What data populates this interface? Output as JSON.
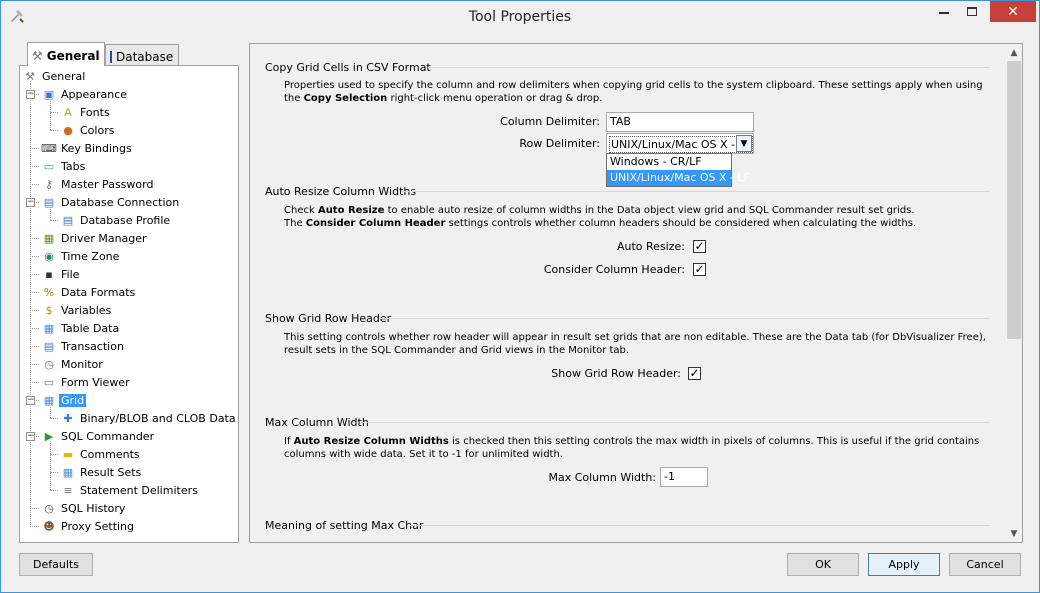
{
  "window": {
    "title": "Tool Properties",
    "close_glyph": "✕"
  },
  "tabs": [
    {
      "label": "General",
      "icon": "tools-icon",
      "active": true
    },
    {
      "label": "Database",
      "icon": "database-icon",
      "active": false
    }
  ],
  "tree": {
    "items": [
      {
        "label": "General",
        "icon": "tools-icon",
        "glyph": "⚒",
        "color": "#7a7a7a"
      },
      {
        "label": "Appearance",
        "icon": "monitor-icon",
        "glyph": "▣",
        "color": "#3a7bd5"
      },
      {
        "label": "Fonts",
        "icon": "font-icon",
        "glyph": "A",
        "color": "#d49b00"
      },
      {
        "label": "Colors",
        "icon": "palette-icon",
        "glyph": "●",
        "color": "#d2691e"
      },
      {
        "label": "Key Bindings",
        "icon": "keyboard-icon",
        "glyph": "⌨",
        "color": "#444444"
      },
      {
        "label": "Tabs",
        "icon": "tabs-icon",
        "glyph": "▭",
        "color": "#4a90d9"
      },
      {
        "label": "Master Password",
        "icon": "key-icon",
        "glyph": "⚷",
        "color": "#777777"
      },
      {
        "label": "Database Connection",
        "icon": "database-connection-icon",
        "glyph": "▤",
        "color": "#3a7bd5"
      },
      {
        "label": "Database Profile",
        "icon": "database-profile-icon",
        "glyph": "▤",
        "color": "#3a7bd5"
      },
      {
        "label": "Driver Manager",
        "icon": "driver-icon",
        "glyph": "▦",
        "color": "#6b8e23"
      },
      {
        "label": "Time Zone",
        "icon": "globe-icon",
        "glyph": "◉",
        "color": "#2e8b57"
      },
      {
        "label": "File",
        "icon": "floppy-icon",
        "glyph": "▪",
        "color": "#333333"
      },
      {
        "label": "Data Formats",
        "icon": "percent-icon",
        "glyph": "%",
        "color": "#b8860b"
      },
      {
        "label": "Variables",
        "icon": "dollar-icon",
        "glyph": "$",
        "color": "#b8860b"
      },
      {
        "label": "Table Data",
        "icon": "table-icon",
        "glyph": "▦",
        "color": "#4a90d9"
      },
      {
        "label": "Transaction",
        "icon": "transaction-icon",
        "glyph": "▤",
        "color": "#3a7bd5"
      },
      {
        "label": "Monitor",
        "icon": "monitor-clock-icon",
        "glyph": "◷",
        "color": "#3a7bd5"
      },
      {
        "label": "Form Viewer",
        "icon": "form-icon",
        "glyph": "▭",
        "color": "#777777"
      },
      {
        "label": "Grid",
        "icon": "grid-icon",
        "glyph": "▦",
        "color": "#4a90d9"
      },
      {
        "label": "Binary/BLOB and CLOB Data",
        "icon": "puzzle-icon",
        "glyph": "✚",
        "color": "#3a7bd5"
      },
      {
        "label": "SQL Commander",
        "icon": "play-icon",
        "glyph": "▶",
        "color": "#2e9e2e"
      },
      {
        "label": "Comments",
        "icon": "note-icon",
        "glyph": "▬",
        "color": "#e6b800"
      },
      {
        "label": "Result Sets",
        "icon": "result-grid-icon",
        "glyph": "▦",
        "color": "#4a90d9"
      },
      {
        "label": "Statement Delimiters",
        "icon": "delimiter-icon",
        "glyph": "≡",
        "color": "#777777"
      },
      {
        "label": "SQL History",
        "icon": "history-icon",
        "glyph": "◷",
        "color": "#555555"
      },
      {
        "label": "Proxy Setting",
        "icon": "proxy-icon",
        "glyph": "☻",
        "color": "#8b5a2b"
      }
    ]
  },
  "sections": {
    "csv": {
      "title": "Copy Grid Cells in CSV Format",
      "desc_a": "Properties used to specify the column and row delimiters when copying grid cells to the system clipboard. These settings apply when using the ",
      "desc_b": "Copy Selection",
      "desc_c": " right-click menu operation or drag & drop.",
      "column_delimiter_label": "Column Delimiter:",
      "column_delimiter_value": "TAB",
      "row_delimiter_label": "Row Delimiter:",
      "row_delimiter_value": "UNIX/Linux/Mac OS X - LF",
      "row_delimiter_options": [
        "Windows - CR/LF",
        "UNIX/Linux/Mac OS X - LF"
      ]
    },
    "auto_resize": {
      "title": "Auto Resize Column Widths",
      "line1_a": "Check ",
      "line1_b": "Auto Resize",
      "line1_c": " to enable auto resize of column widths in the Data object view grid and SQL Commander result set grids.",
      "line2_a": "The ",
      "line2_b": "Consider Column Header",
      "line2_c": " settings controls whether column headers should be considered when calculating the widths.",
      "auto_resize_label": "Auto Resize:",
      "consider_header_label": "Consider Column Header:",
      "check_glyph": "✓"
    },
    "row_header": {
      "title": "Show Grid Row Header",
      "desc": "This setting controls whether row header will appear in result set grids that are non editable. These are the Data tab (for DbVisualizer Free), result sets in the SQL Commander and Grid views in the Monitor tab.",
      "label": "Show Grid Row Header:"
    },
    "max_width": {
      "title": "Max Column Width",
      "desc_a": "If ",
      "desc_b": "Auto Resize Column Widths",
      "desc_c": " is checked then this setting controls the max width in pixels of columns. This is useful if the grid contains columns with wide data. Set it to -1 for unlimited width.",
      "label": "Max Column Width:",
      "value": "-1"
    },
    "max_char": {
      "title": "Meaning of setting Max Char"
    }
  },
  "buttons": {
    "defaults": "Defaults",
    "ok": "OK",
    "apply": "Apply",
    "cancel": "Cancel"
  }
}
